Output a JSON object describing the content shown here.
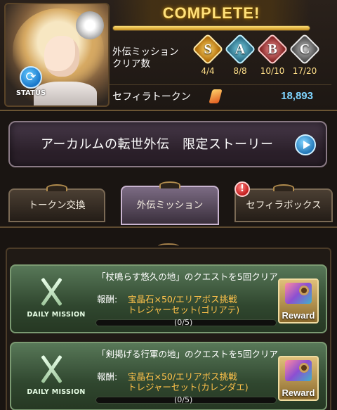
{
  "header": {
    "complete_banner": "COMPLETE!",
    "progress_fraction": 1.0,
    "status_label": "STATUS",
    "clear_label_line1": "外伝ミッション",
    "clear_label_line2": "クリア数",
    "ranks": [
      {
        "rank": "S",
        "count": "4/4",
        "color": "#f2b63a"
      },
      {
        "rank": "A",
        "count": "8/8",
        "color": "#4aa7c1"
      },
      {
        "rank": "B",
        "count": "10/10",
        "color": "#c14a4a"
      },
      {
        "rank": "C",
        "count": "17/20",
        "color": "#9a9a9a"
      }
    ],
    "token_label": "セフィラトークン",
    "token_icon": "sephira-token-icon",
    "token_value": "18,893"
  },
  "story_button": {
    "label": "アーカルムの転世外伝　限定ストーリー",
    "arrow_icon": "play-arrow-icon"
  },
  "tabs": [
    {
      "label": "トークン交換",
      "active": false
    },
    {
      "label": "外伝ミッション",
      "active": true
    },
    {
      "label": "セフィラボックス",
      "active": false,
      "alert": "!"
    }
  ],
  "missions": [
    {
      "badge": "DAILY MISSION",
      "title": "「杖鳴らす悠久の地」のクエストを5回クリア",
      "reward_prefix": "報酬:",
      "reward_line1": "宝晶石×50/エリアボス挑戦",
      "reward_line2": "トレジャーセット(ゴリアテ)",
      "progress": "(0/5)",
      "progress_fraction": 0,
      "reward_button": "Reward"
    },
    {
      "badge": "DAILY MISSION",
      "title": "「剣掲げる行軍の地」のクエストを5回クリア",
      "reward_prefix": "報酬:",
      "reward_line1": "宝晶石×50/エリアボス挑戦",
      "reward_line2": "トレジャーセット(カレンダエ)",
      "progress": "(0/5)",
      "progress_fraction": 0,
      "reward_button": "Reward"
    }
  ]
}
